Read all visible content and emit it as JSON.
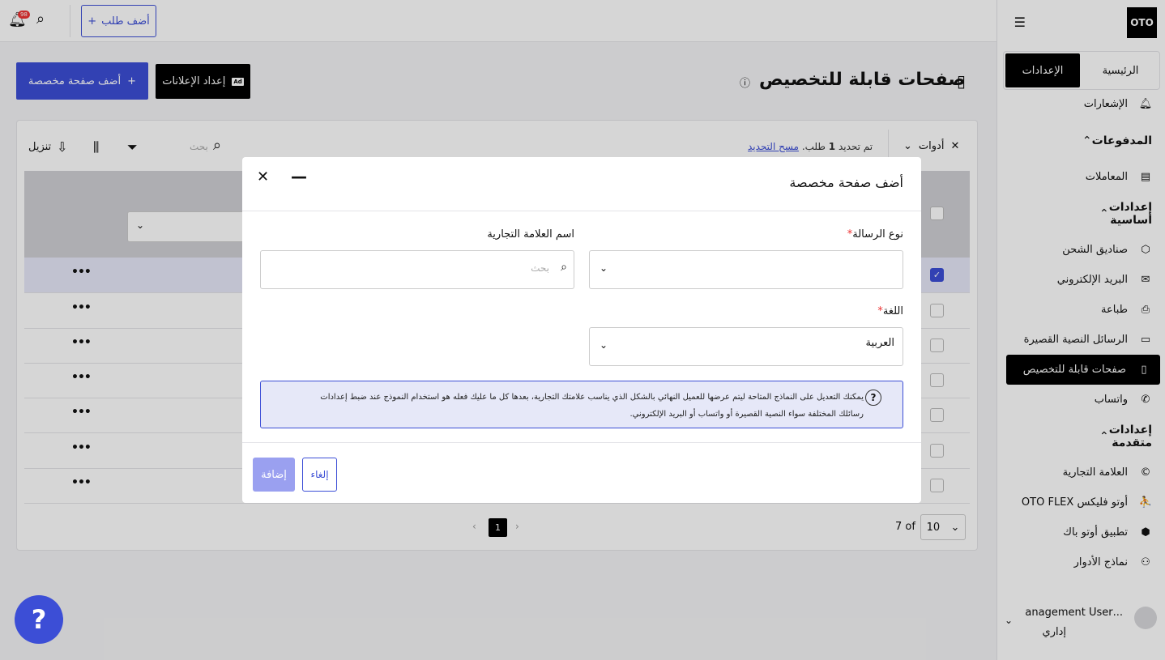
{
  "app": {
    "logo": "OTO"
  },
  "topbar": {
    "add_order_label": "أضف طلب",
    "notification_count": "98"
  },
  "sidebar": {
    "tabs": [
      "الرئيسية",
      "الإعدادات"
    ],
    "items_top": [
      {
        "label": "الإشعارات",
        "icon": "bell-icon"
      }
    ],
    "sections": [
      {
        "title": "المدفوعات",
        "items": [
          {
            "label": "المعاملات",
            "icon": "receipt-icon"
          }
        ]
      },
      {
        "title": "إعدادات أساسية",
        "items": [
          {
            "label": "صناديق الشحن",
            "icon": "box-icon"
          },
          {
            "label": "البريد الإلكتروني",
            "icon": "mail-icon"
          },
          {
            "label": "طباعة",
            "icon": "printer-icon"
          },
          {
            "label": "الرسائل النصية القصيرة",
            "icon": "sms-icon"
          },
          {
            "label": "صفحات قابلة للتخصيص",
            "icon": "page-icon"
          },
          {
            "label": "واتساب",
            "icon": "phone-icon"
          }
        ]
      },
      {
        "title": "إعدادات متقدمة",
        "items": [
          {
            "label": "العلامة التجارية",
            "icon": "copyright-icon"
          },
          {
            "label": "أوتو فليكس OTO FLEX",
            "icon": "courier-icon"
          },
          {
            "label": "تطبيق أوتو باك",
            "icon": "package-icon"
          },
          {
            "label": "نماذج الأدوار",
            "icon": "users-icon"
          }
        ]
      }
    ],
    "user": {
      "name": "...anagement User",
      "role": "إداري"
    }
  },
  "page": {
    "title": "صفحات قابلة للتخصيص",
    "ads_button": "إعداد الإعلانات",
    "ad_badge": "Ad",
    "add_page_button": "أضف صفحة مخصصة"
  },
  "table": {
    "tools_label": "أدوات",
    "selected_text": "تم تحديد",
    "selected_count": "1",
    "selected_suffix": "طلب.",
    "clear_label": "مسح التحديد",
    "search_placeholder": "بحث",
    "download_label": "تنزيل",
    "rows_count": 7,
    "page_size": "10",
    "of_label": "7 of",
    "current_page": "1"
  },
  "modal": {
    "title": "أضف صفحة مخصصة",
    "message_type_label": "نوع الرسالة",
    "brand_name_label": "اسم العلامة التجارية",
    "brand_search_placeholder": "بحث",
    "language_label": "اللغة",
    "language_value": "العربية",
    "hint": "يمكنك التعديل على النماذج المتاحة ليتم عرضها للعميل النهائي بالشكل الذي يناسب علامتك التجارية، بعدها كل ما عليك فعله هو استخدام النموذج عند ضبط إعدادات رسائلك المختلفة سواء النصية القصيرة أو واتساب أو البريد الإلكتروني.",
    "cancel_label": "إلغاء",
    "submit_label": "إضافة"
  },
  "help": {
    "label": "?"
  },
  "colors": {
    "primary": "#3c4ed6",
    "danger": "#e33333",
    "black": "#000000"
  }
}
